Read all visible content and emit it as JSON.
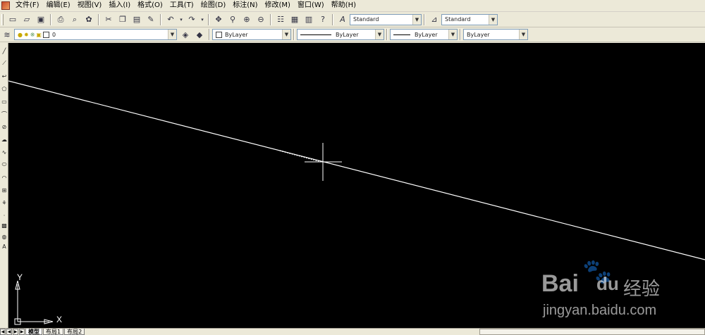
{
  "menu": [
    "文件(F)",
    "编辑(E)",
    "视图(V)",
    "插入(I)",
    "格式(O)",
    "工具(T)",
    "绘图(D)",
    "标注(N)",
    "修改(M)",
    "窗口(W)",
    "帮助(H)"
  ],
  "styles": {
    "text_style": "Standard",
    "dim_style": "Standard"
  },
  "layer": {
    "name": "0"
  },
  "properties": {
    "color": "ByLayer",
    "linetype": "ByLayer",
    "lineweight": "ByLayer",
    "plotstyle": "ByLayer"
  },
  "ucs": {
    "x_label": "X",
    "y_label": "Y"
  },
  "tabs": [
    "模型",
    "布局1",
    "布局2"
  ],
  "watermark": {
    "brand": "Bai",
    "brand2": "du",
    "cn": "经验",
    "url": "jingyan.baidu.com"
  },
  "colors": {
    "canvas": "#000000",
    "drawing_line": "#ffffff",
    "chrome": "#ece9d8"
  }
}
